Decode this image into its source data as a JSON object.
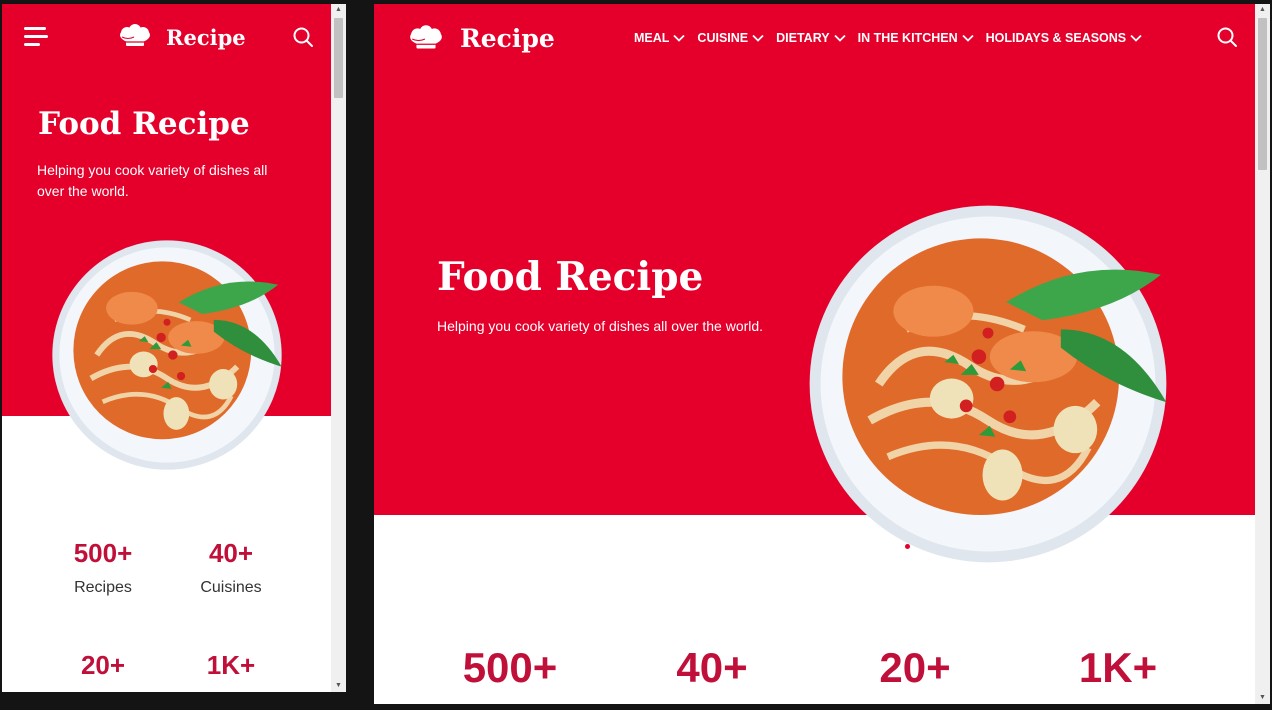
{
  "brand": {
    "name": "Recipe",
    "accent": "#e4002b",
    "stat_color": "#c0103a"
  },
  "nav": {
    "items": [
      {
        "label": "MEAL"
      },
      {
        "label": "CUISINE"
      },
      {
        "label": "DIETARY"
      },
      {
        "label": "IN THE KITCHEN"
      },
      {
        "label": "HOLIDAYS & SEASONS"
      }
    ],
    "icons": {
      "menu": "hamburger-icon",
      "search": "search-icon",
      "dropdown": "chevron-down-icon",
      "logo": "chef-hat-icon"
    }
  },
  "hero": {
    "title": "Food Recipe",
    "subtitle": "Helping you cook variety of dishes all over the world."
  },
  "stats": [
    {
      "value": "500+",
      "label": "Recipes"
    },
    {
      "value": "40+",
      "label": "Cuisines"
    },
    {
      "value": "20+",
      "label": ""
    },
    {
      "value": "1K+",
      "label": ""
    }
  ]
}
